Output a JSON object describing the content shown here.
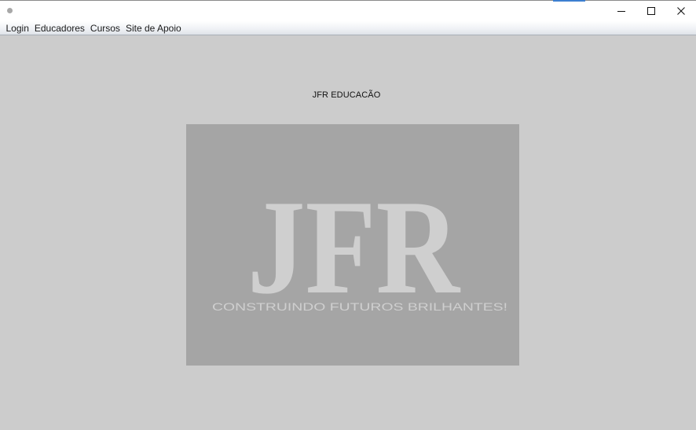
{
  "window": {
    "accent_color": "#3d7fd1"
  },
  "menu": {
    "items": [
      "Login",
      "Educadores",
      "Cursos",
      "Site de Apoio"
    ]
  },
  "main": {
    "heading": "JFR EDUCACÃO",
    "logo": {
      "wordmark": "JFR",
      "tagline": "CONSTRUINDO FUTUROS BRILHANTES!",
      "background_color": "#a5a5a5",
      "text_color": "#cfcfcf"
    }
  },
  "icons": {
    "app": "app-icon",
    "minimize": "minimize-icon",
    "maximize": "maximize-icon",
    "close": "close-icon"
  }
}
